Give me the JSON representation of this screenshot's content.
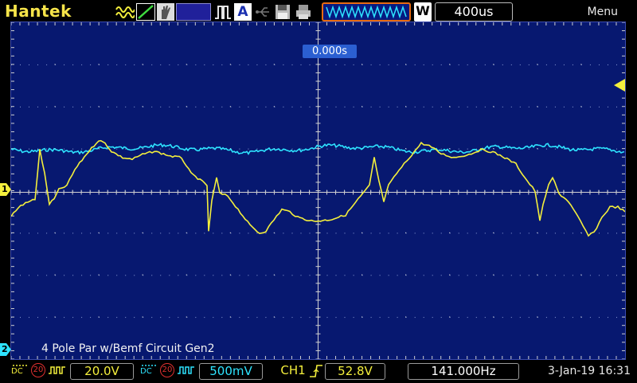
{
  "brand": "Hantek",
  "header": {
    "timebase": "400us",
    "trigger_mode_badge": "W",
    "menu_label": "Menu"
  },
  "screen": {
    "trigger_time": "0.000s",
    "note": "4 Pole Par w/Bemf Circuit Gen2",
    "ch1_marker": "1",
    "ch2_marker": "2"
  },
  "channels": {
    "ch1": {
      "coupling": "DC",
      "bw_limit": "20",
      "scale": "20.0V",
      "color": "#f4ef3c"
    },
    "ch2": {
      "coupling": "DC",
      "bw_limit": "20",
      "scale": "500mV",
      "color": "#2ee4ff"
    }
  },
  "trigger": {
    "source": "CH1",
    "level": "52.8V"
  },
  "frequency": "141.000Hz",
  "datetime": "3-Jan-19 16:31",
  "colors": {
    "screen_bg": "#071870",
    "grid": "#d0d0d0",
    "trigger_box": "#e86b12",
    "brand": "#f6e44a"
  }
}
